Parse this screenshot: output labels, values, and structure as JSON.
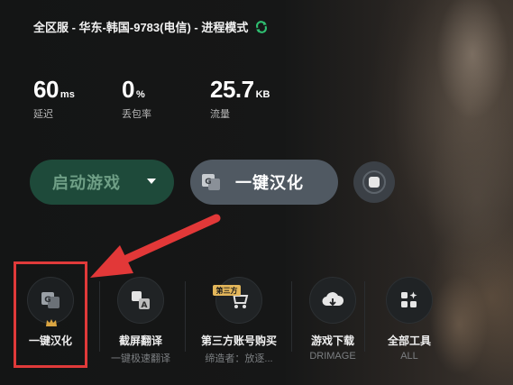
{
  "header": {
    "title": "全区服 - 华东-韩国-9783(电信) - 进程模式"
  },
  "stats": [
    {
      "value": "60",
      "unit": "ms",
      "label": "延迟"
    },
    {
      "value": "0",
      "unit": "%",
      "label": "丢包率"
    },
    {
      "value": "25.7",
      "unit": "KB",
      "label": "流量"
    }
  ],
  "buttons": {
    "start_game": "启动游戏",
    "one_click_localize": "一键汉化"
  },
  "tools": [
    {
      "name": "一键汉化",
      "sub": ""
    },
    {
      "name": "截屏翻译",
      "sub": "一键极速翻译"
    },
    {
      "name": "第三方账号购买",
      "sub": "缔造者：放逐...",
      "badge": "第三方"
    },
    {
      "name": "游戏下载",
      "sub": "DRIMAGE"
    },
    {
      "name": "全部工具",
      "sub": "ALL"
    }
  ],
  "colors": {
    "accent_green": "#1e4a3a",
    "highlight_red": "#e03a3a",
    "badge_gold": "#e3b65a"
  }
}
